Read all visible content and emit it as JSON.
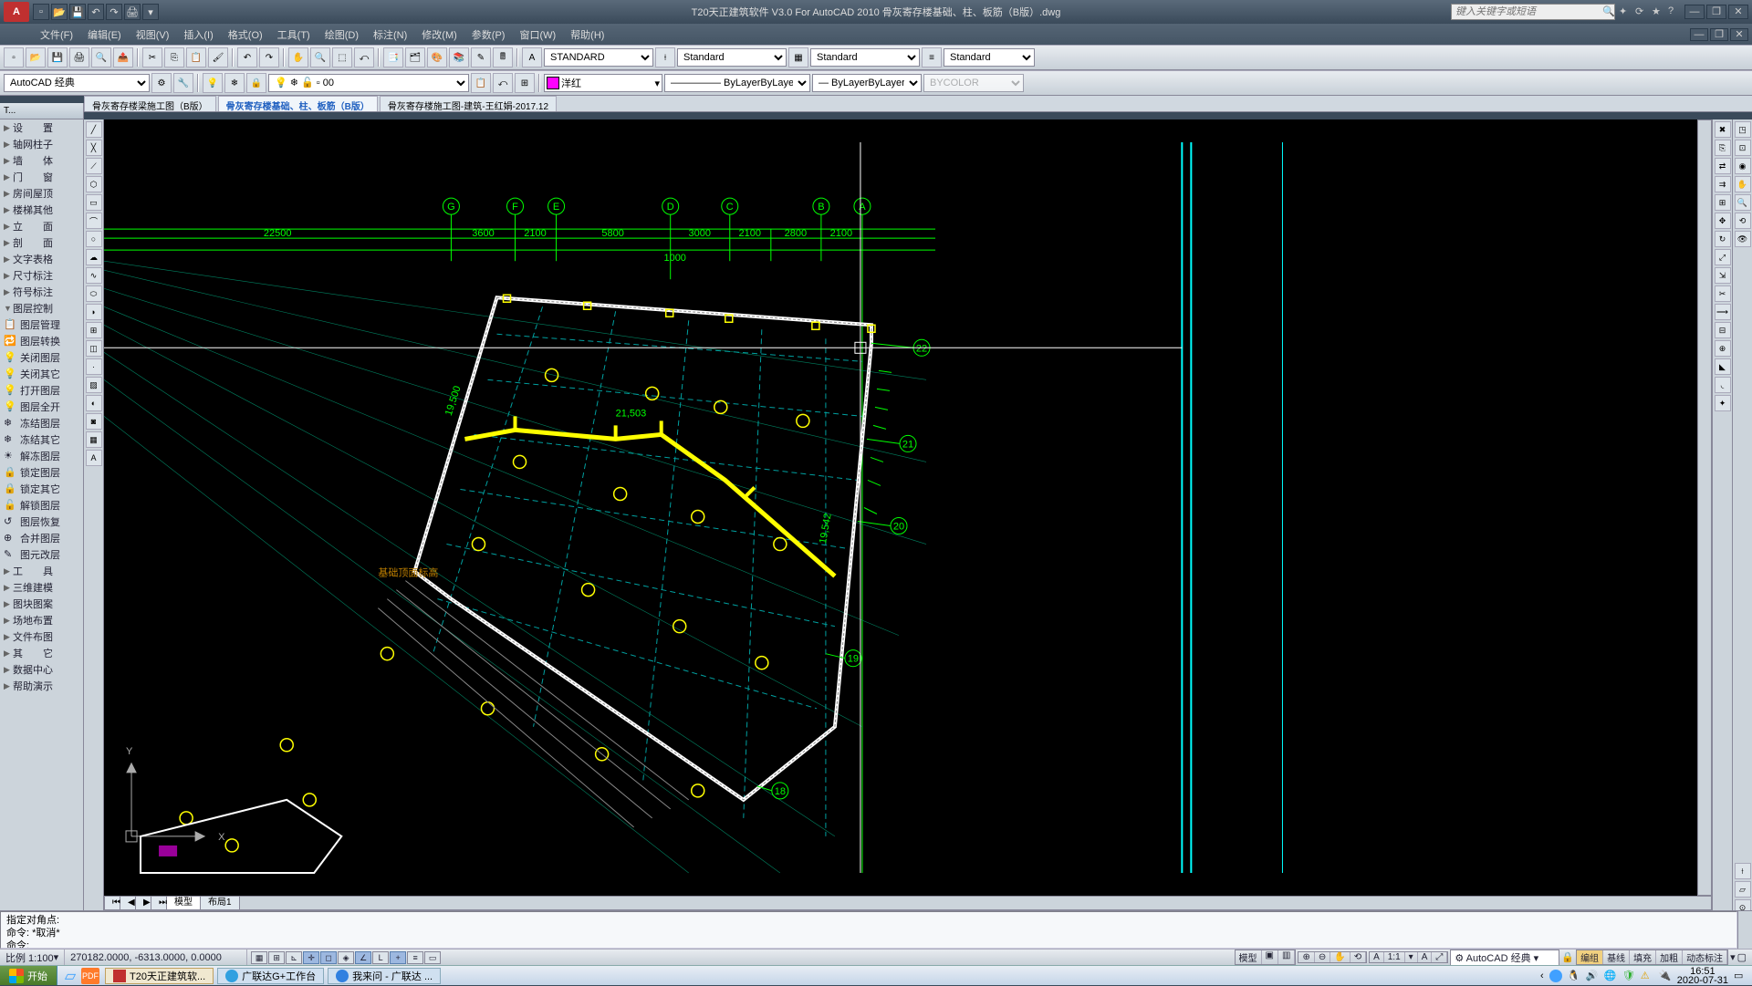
{
  "app": {
    "title": "T20天正建筑软件 V3.0 For AutoCAD 2010  骨灰寄存楼基础、柱、板筋（B版）.dwg",
    "search_placeholder": "键入关键字或短语"
  },
  "menu": [
    "文件(F)",
    "编辑(E)",
    "视图(V)",
    "插入(I)",
    "格式(O)",
    "工具(T)",
    "绘图(D)",
    "标注(N)",
    "修改(M)",
    "参数(P)",
    "窗口(W)",
    "帮助(H)"
  ],
  "workspace_combo": "AutoCAD 经典",
  "layer_combo": "0",
  "style_combos": {
    "text": "STANDARD",
    "dim": "Standard",
    "table": "Standard",
    "ml": "Standard"
  },
  "color_combo": "洋红",
  "linetype_combo": "ByLayer",
  "lineweight_combo": "ByLayer",
  "plotstyle_combo": "BYCOLOR",
  "doc_tabs": [
    {
      "label": "骨灰寄存楼梁施工图（B版）",
      "active": false
    },
    {
      "label": "骨灰寄存楼基础、柱、板筋（B版）",
      "active": true
    },
    {
      "label": "骨灰寄存楼施工图-建筑-王红娟-2017.12",
      "active": false
    }
  ],
  "left_panel_header": "T...",
  "left_panel_groups": [
    "设　　置",
    "轴网柱子",
    "墙　　体",
    "门　　窗",
    "房间屋顶",
    "楼梯其他",
    "立　　面",
    "剖　　面",
    "文字表格",
    "尺寸标注",
    "符号标注",
    "图层控制"
  ],
  "left_panel_layer_cmds": [
    "图层管理",
    "图层转换",
    "关闭图层",
    "关闭其它",
    "打开图层",
    "图层全开",
    "冻结图层",
    "冻结其它",
    "解冻图层",
    "锁定图层",
    "锁定其它",
    "解锁图层",
    "图层恢复",
    "合并图层",
    "图元改层"
  ],
  "left_panel_groups2": [
    "工　　具",
    "三维建模",
    "图块图案",
    "场地布置",
    "文件布图",
    "其　　它",
    "数据中心",
    "帮助演示"
  ],
  "model_tabs": {
    "model": "模型",
    "layout": "布局1"
  },
  "command_history": [
    "指定对角点:",
    "命令: *取消*"
  ],
  "command_prompt": "命令:",
  "status": {
    "scale": "比例 1:100",
    "coords": "270182.0000, -6313.0000, 0.0000",
    "mode_right_label": "模型",
    "anno": "1:1",
    "workspace": "AutoCAD 经典",
    "toggles": [
      "编组",
      "基线",
      "填充",
      "加粗",
      "动态标注"
    ]
  },
  "drawing": {
    "grid_labels": [
      "G",
      "F",
      "E",
      "D",
      "C",
      "B",
      "A"
    ],
    "dim_top_total": "22500",
    "dims_top": [
      "3600",
      "2100",
      "5800",
      "3000",
      "2100",
      "2800",
      "2100"
    ],
    "dim_small": "1000",
    "radial_labels": [
      "18",
      "19",
      "20",
      "21",
      "22"
    ],
    "ucs": {
      "x": "X",
      "y": "Y"
    },
    "beam_dims": [
      "19,500",
      "21,503",
      "19,542"
    ],
    "section_label": "基础顶面标高"
  },
  "taskbar": {
    "start": "开始",
    "tasks": [
      {
        "label": "T20天正建筑软...",
        "active": true,
        "color": "#c03030"
      },
      {
        "label": "广联达G+工作台",
        "active": false,
        "color": "#30a0e0"
      },
      {
        "label": "我来问 - 广联达 ...",
        "active": false,
        "color": "#3080e0"
      }
    ],
    "time": "16:51",
    "date": "2020-07-31"
  }
}
